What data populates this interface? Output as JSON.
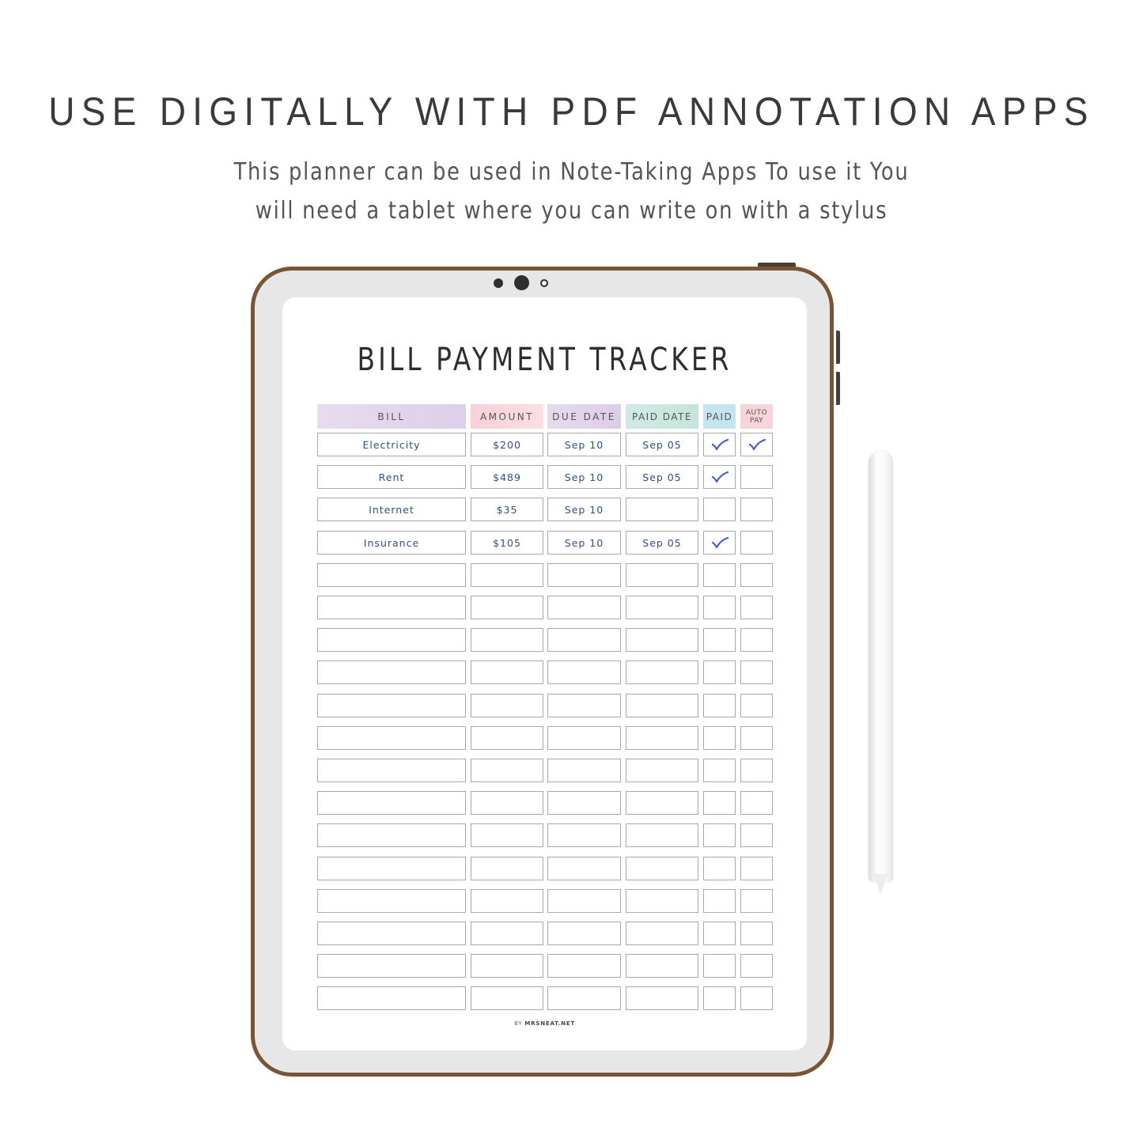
{
  "headline": "USE DIGITALLY WITH PDF ANNOTATION APPS",
  "subtitle": {
    "line1": "This planner can be used in Note-Taking Apps  To use it You",
    "line2": "will need a tablet where you can write on with a stylus"
  },
  "planner": {
    "title": "BILL PAYMENT TRACKER",
    "columns": [
      {
        "key": "bill",
        "label": "BILL",
        "color": "#e0d4ec"
      },
      {
        "key": "amount",
        "label": "AMOUNT",
        "color": "#f9d3da"
      },
      {
        "key": "due_date",
        "label": "DUE DATE",
        "color": "#e2d6ec"
      },
      {
        "key": "paid_date",
        "label": "PAID DATE",
        "color": "#cde9e3"
      },
      {
        "key": "paid",
        "label": "PAID",
        "color": "#c5e4f1"
      },
      {
        "key": "auto_pay",
        "label_line1": "AUTO",
        "label_line2": "PAY",
        "color": "#f9d3da"
      }
    ],
    "rows": [
      {
        "bill": "Electricity",
        "amount": "$200",
        "due_date": "Sep 10",
        "paid_date": "Sep 05",
        "paid": true,
        "auto_pay": true
      },
      {
        "bill": "Rent",
        "amount": "$489",
        "due_date": "Sep 10",
        "paid_date": "Sep 05",
        "paid": true,
        "auto_pay": false
      },
      {
        "bill": "Internet",
        "amount": "$35",
        "due_date": "Sep 10",
        "paid_date": "",
        "paid": false,
        "auto_pay": false
      },
      {
        "bill": "Insurance",
        "amount": "$105",
        "due_date": "Sep 10",
        "paid_date": "Sep 05",
        "paid": true,
        "auto_pay": false
      },
      {},
      {},
      {},
      {},
      {},
      {},
      {},
      {},
      {},
      {},
      {},
      {},
      {},
      {}
    ],
    "credit_prefix": "BY",
    "credit_site": "MRSNEAT.NET",
    "handwriting_color": "#2f4f8c",
    "check_color": "#4a5fc9"
  },
  "device": {
    "frame_color": "#7a5535",
    "bezel_color": "#e7e7e7"
  }
}
